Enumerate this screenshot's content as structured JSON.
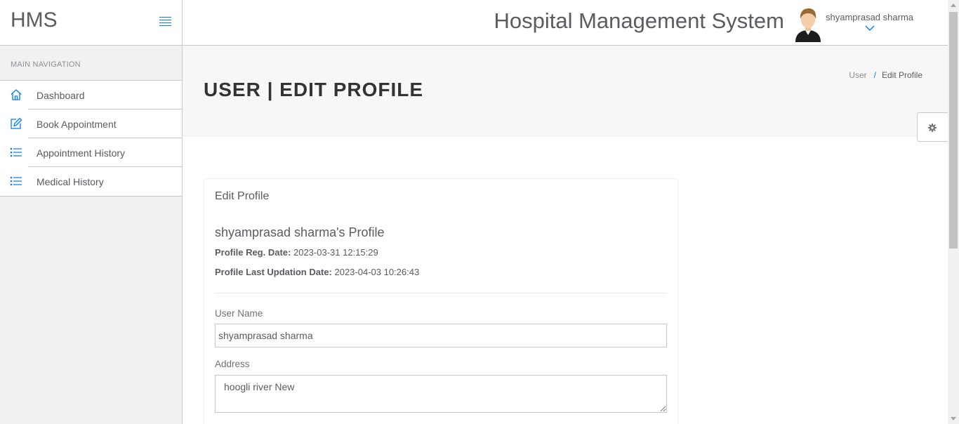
{
  "brand": {
    "name": "HMS"
  },
  "sidebar": {
    "nav_header": "MAIN NAVIGATION",
    "items": [
      {
        "label": "Dashboard",
        "icon": "home-icon"
      },
      {
        "label": "Book Appointment",
        "icon": "edit-icon"
      },
      {
        "label": "Appointment History",
        "icon": "list-icon"
      },
      {
        "label": "Medical History",
        "icon": "list-icon"
      }
    ]
  },
  "topbar": {
    "app_title": "Hospital Management System",
    "user_name": "shyamprasad sharma"
  },
  "page": {
    "title": "USER | EDIT PROFILE",
    "breadcrumb": {
      "parent": "User",
      "separator": "/",
      "current": "Edit Profile"
    }
  },
  "panel": {
    "heading": "Edit Profile",
    "profile_title": "shyamprasad sharma's Profile",
    "reg_date_label": "Profile Reg. Date:",
    "reg_date_value": "2023-03-31 12:15:29",
    "update_date_label": "Profile Last Updation Date:",
    "update_date_value": "2023-04-03 10:26:43",
    "fields": {
      "user_name_label": "User Name",
      "user_name_value": "shyamprasad sharma",
      "address_label": "Address",
      "address_value": "hoogli river New"
    }
  },
  "colors": {
    "accent": "#007aff",
    "text": "#5b5b60",
    "border": "#c8c7cc",
    "sidebar_bg": "#f1f1f2"
  }
}
